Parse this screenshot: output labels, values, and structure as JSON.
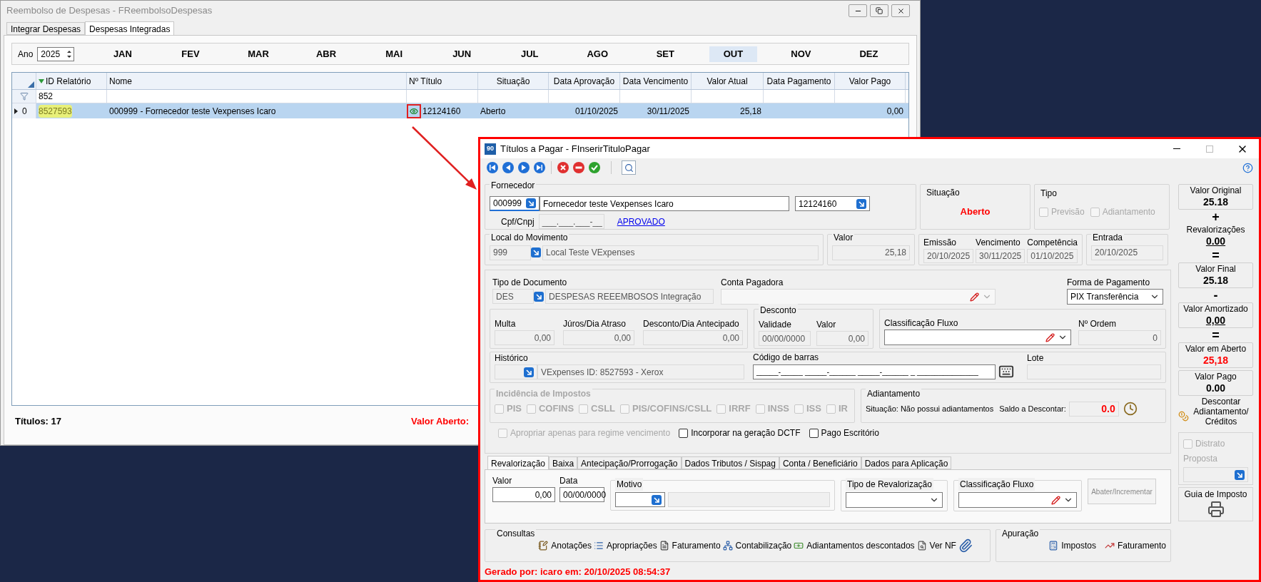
{
  "back_window": {
    "title": "Reembolso de Despesas - FReembolsoDespesas",
    "tabs": [
      {
        "label": "Integrar Despesas",
        "selected": false
      },
      {
        "label": "Despesas Integradas",
        "selected": true
      }
    ],
    "year_label": "Ano",
    "year": "2025",
    "months": [
      {
        "label": "JAN",
        "selected": false
      },
      {
        "label": "FEV",
        "selected": false
      },
      {
        "label": "MAR",
        "selected": false
      },
      {
        "label": "ABR",
        "selected": false
      },
      {
        "label": "MAI",
        "selected": false
      },
      {
        "label": "JUN",
        "selected": false
      },
      {
        "label": "JUL",
        "selected": false
      },
      {
        "label": "AGO",
        "selected": false
      },
      {
        "label": "SET",
        "selected": false
      },
      {
        "label": "OUT",
        "selected": true
      },
      {
        "label": "NOV",
        "selected": false
      },
      {
        "label": "DEZ",
        "selected": false
      }
    ],
    "grid": {
      "columns": [
        "ID Relatório",
        "Nome",
        "Nº Título",
        "Situação",
        "Data Aprovação",
        "Data Vencimento",
        "Valor Atual",
        "Data Pagamento",
        "Valor Pago"
      ],
      "filter_value": "852",
      "rows": [
        {
          "row_header": "0",
          "selected": true,
          "highlighted_id": true,
          "preview_icon": true,
          "cells": [
            "8527593",
            "000999 - Fornecedor teste Vexpenses Icaro",
            "12124160",
            "Aberto",
            "01/10/2025",
            "30/11/2025",
            "25,18",
            null,
            "0,00"
          ]
        }
      ]
    },
    "footer": {
      "count": "Títulos: 17",
      "open_value_label": "Valor Aberto:"
    }
  },
  "dialog": {
    "logo": "90",
    "title": "Títulos a Pagar - FInserirTituloPagar",
    "fornecedor": {
      "label": "Fornecedor",
      "code": "000999",
      "name": "Fornecedor teste Vexpenses Icaro",
      "document_number": "12124160",
      "cpf_label": "Cpf/Cnpj",
      "cpf_mask": "___.___.___-__",
      "status_link": "APROVADO"
    },
    "situacao": {
      "label": "Situação",
      "value": "Aberto"
    },
    "tipo": {
      "label": "Tipo",
      "options": [
        {
          "label": "Previsão",
          "checked": false,
          "disabled": true
        },
        {
          "label": "Adiantamento",
          "checked": false,
          "disabled": true
        }
      ]
    },
    "local": {
      "label": "Local do Movimento",
      "code": "999",
      "name": "Local Teste VExpenses"
    },
    "valor": {
      "label": "Valor",
      "value": "25,18"
    },
    "dates": [
      {
        "label": "Emissão",
        "value": "20/10/2025"
      },
      {
        "label": "Vencimento",
        "value": "30/11/2025"
      },
      {
        "label": "Competência",
        "value": "01/10/2025"
      }
    ],
    "entrada": {
      "label": "Entrada",
      "value": "20/10/2025"
    },
    "tipo_documento": {
      "label": "Tipo de Documento",
      "code": "DES",
      "name": "DESPESAS REEEMBOSOS Integração"
    },
    "conta_pagadora": {
      "label": "Conta Pagadora"
    },
    "forma_pagamento": {
      "label": "Forma de Pagamento",
      "value": "PIX Transferência"
    },
    "encargos": [
      {
        "label": "Multa",
        "value": "0,00"
      },
      {
        "label": "Júros/Dia Atraso",
        "value": "0,00"
      },
      {
        "label": "Desconto/Dia Antecipado",
        "value": "0,00"
      }
    ],
    "desconto": {
      "title": "Desconto",
      "fields": [
        {
          "label": "Validade",
          "value": "00/00/0000"
        },
        {
          "label": "Valor",
          "value": "0,00"
        }
      ]
    },
    "classificacao_fluxo": {
      "label": "Classificação Fluxo"
    },
    "numero_ordem": {
      "label": "Nº Ordem",
      "value": "0"
    },
    "historico": {
      "label": "Histórico",
      "value": "VExpenses ID: 8527593 - Xerox"
    },
    "codigo_barras": {
      "label": "Código de barras",
      "mask": "_____-_____ _____-______ _____-______ _ ______________"
    },
    "lote": {
      "label": "Lote"
    },
    "impostos": {
      "title": "Incidência de Impostos",
      "disabled": true,
      "items": [
        {
          "label": "PIS",
          "checked": false
        },
        {
          "label": "COFINS",
          "checked": false
        },
        {
          "label": "CSLL",
          "checked": false
        },
        {
          "label": "PIS/COFINS/CSLL",
          "checked": false
        },
        {
          "label": "IRRF",
          "checked": false
        },
        {
          "label": "INSS",
          "checked": false
        },
        {
          "label": "ISS",
          "checked": false
        },
        {
          "label": "IR",
          "checked": false
        }
      ]
    },
    "adiantamento": {
      "title": "Adiantamento",
      "status": "Situação: Não possui adiantamentos",
      "saldo_label": "Saldo a Descontar:",
      "saldo": "0.0"
    },
    "options": [
      {
        "label": "Apropriar apenas para regime vencimento",
        "checked": false,
        "disabled": true
      },
      {
        "label": "Incorporar na geração DCTF",
        "checked": false,
        "disabled": false
      },
      {
        "label": "Pago Escritório",
        "checked": false,
        "disabled": false
      }
    ],
    "tabs": [
      {
        "label": "Revalorização",
        "selected": true
      },
      {
        "label": "Baixa",
        "selected": false
      },
      {
        "label": "Antecipação/Prorrogação",
        "selected": false
      },
      {
        "label": "Dados Tributos / Sispag",
        "selected": false
      },
      {
        "label": "Conta / Beneficiário",
        "selected": false
      },
      {
        "label": "Dados para Aplicação",
        "selected": false
      }
    ],
    "revalorizacao": {
      "valor_label": "Valor",
      "valor": "0,00",
      "data_label": "Data",
      "data": "00/00/0000",
      "motivo_label": "Motivo",
      "tipo_label": "Tipo de Revalorização",
      "classificacao_label": "Classificação Fluxo",
      "button": {
        "label": "Abater/Incrementar",
        "disabled": true
      }
    },
    "consultas": {
      "title": "Consultas",
      "items": [
        "Anotações",
        "Apropriações",
        "Faturamento",
        "Contabilização",
        "Adiantamentos descontados",
        "Ver NF"
      ]
    },
    "apuracao": {
      "title": "Apuração",
      "items": [
        "Impostos",
        "Faturamento"
      ]
    },
    "summary": [
      {
        "kind": "value",
        "label": "Valor Original",
        "value": "25.18",
        "boxed": true,
        "underlined": false,
        "alert": false
      },
      {
        "kind": "operator",
        "symbol": "+"
      },
      {
        "kind": "value",
        "label": "Revalorizações",
        "value": "0.00",
        "boxed": false,
        "underlined": true,
        "alert": false
      },
      {
        "kind": "operator",
        "symbol": "="
      },
      {
        "kind": "value",
        "label": "Valor Final",
        "value": "25.18",
        "boxed": true,
        "underlined": false,
        "alert": false
      },
      {
        "kind": "operator",
        "symbol": "-"
      },
      {
        "kind": "value",
        "label": "Valor Amortizado",
        "value": "0,00",
        "boxed": true,
        "underlined": true,
        "alert": false
      },
      {
        "kind": "operator",
        "symbol": "="
      },
      {
        "kind": "value",
        "label": "Valor em Aberto",
        "value": "25,18",
        "boxed": true,
        "underlined": false,
        "alert": true
      },
      {
        "kind": "value",
        "label": "Valor Pago",
        "value": "0.00",
        "boxed": true,
        "underlined": false,
        "alert": false
      }
    ],
    "descontar": "Descontar Adiantamento/ Créditos",
    "distrato": {
      "label": "Distrato",
      "checked": false,
      "disabled": true,
      "proposta_label": "Proposta"
    },
    "guia": {
      "label": "Guia de Imposto"
    },
    "footer": "Gerado por: icaro em: 20/10/2025 08:54:37"
  }
}
